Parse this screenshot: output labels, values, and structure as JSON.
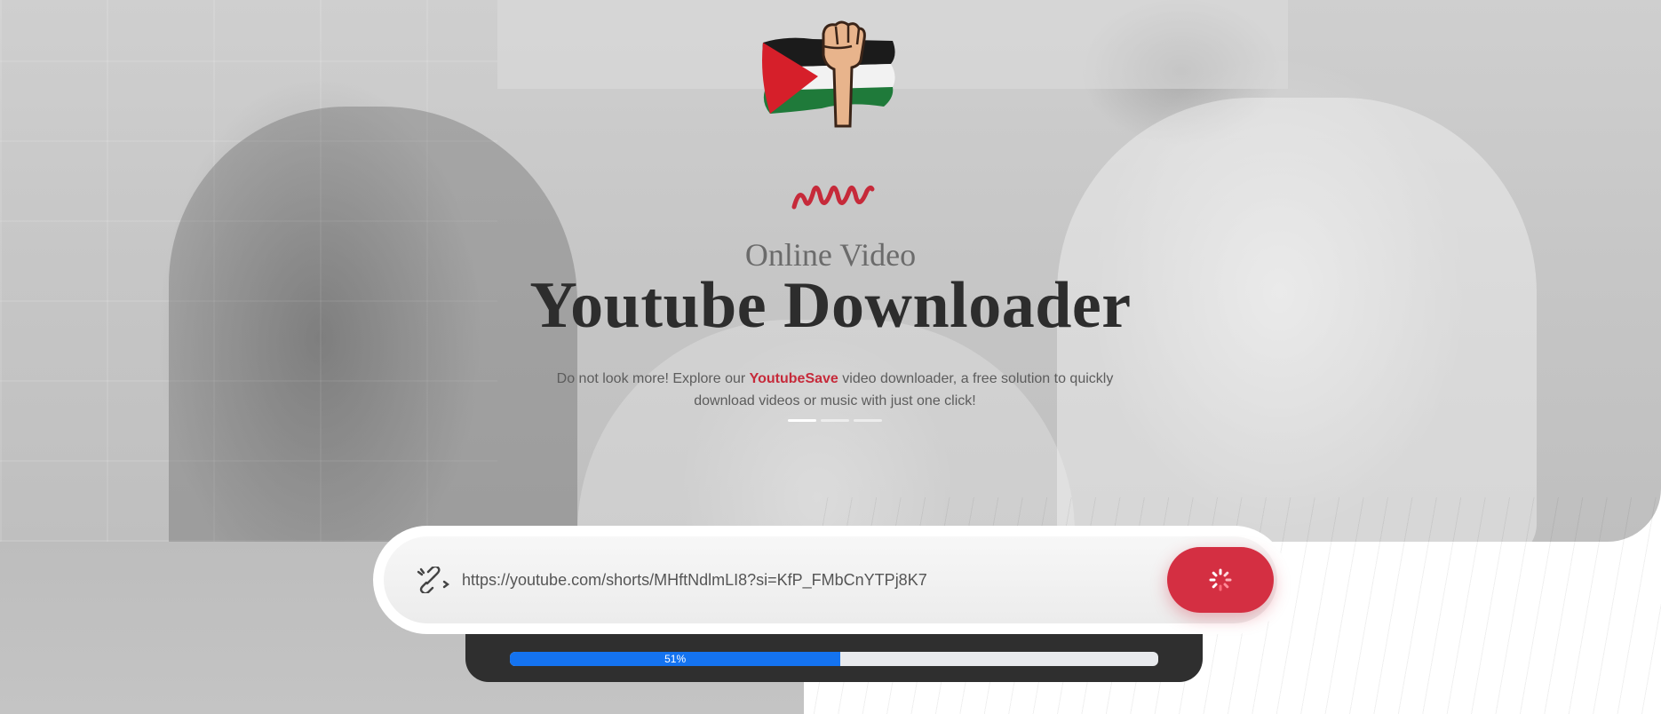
{
  "hero": {
    "eyebrow": "Online Video",
    "title": "Youtube Downloader",
    "description_before": "Do not look more! Explore our ",
    "brand_name": "YoutubeSave",
    "description_after": " video downloader, a free solution to quickly download videos or music with just one click!",
    "slides": {
      "count": 3,
      "active": 1
    }
  },
  "search": {
    "link_icon": "link-icon",
    "url_value": "https://youtube.com/shorts/MHftNdlmLI8?si=KfP_FMbCnYTPj8K7",
    "submit_icon": "spinner-icon"
  },
  "progress": {
    "label": "51%",
    "fraction": 0.51
  },
  "colors": {
    "accent": "#d42f42",
    "progress": "#1473f0",
    "panel": "#2f2f2f"
  }
}
